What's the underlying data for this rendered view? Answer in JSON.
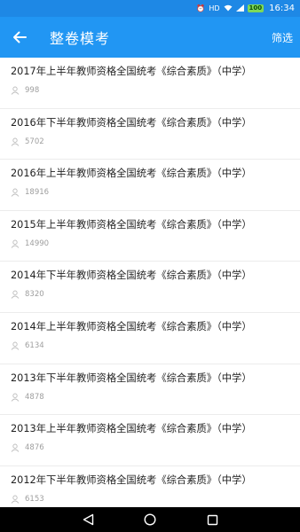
{
  "status_bar": {
    "battery": "100",
    "time": "16:34"
  },
  "header": {
    "title": "整卷模考",
    "filter_label": "筛选"
  },
  "items": [
    {
      "title": "2017年上半年教师资格全国统考《综合素质》（中学）",
      "count": "998"
    },
    {
      "title": "2016年下半年教师资格全国统考《综合素质》（中学）",
      "count": "5702"
    },
    {
      "title": "2016年上半年教师资格全国统考《综合素质》（中学）",
      "count": "18916"
    },
    {
      "title": "2015年上半年教师资格全国统考《综合素质》（中学）",
      "count": "14990"
    },
    {
      "title": "2014年下半年教师资格全国统考《综合素质》（中学）",
      "count": "8320"
    },
    {
      "title": "2014年上半年教师资格全国统考《综合素质》（中学）",
      "count": "6134"
    },
    {
      "title": "2013年下半年教师资格全国统考《综合素质》（中学）",
      "count": "4878"
    },
    {
      "title": "2013年上半年教师资格全国统考《综合素质》（中学）",
      "count": "4876"
    },
    {
      "title": "2012年下半年教师资格全国统考《综合素质》（中学）",
      "count": "6153"
    }
  ],
  "colors": {
    "app_bar": "#2196f3",
    "status_bar": "#1e88e5"
  },
  "icons": {
    "back": "arrow-left-icon",
    "person": "person-icon"
  }
}
